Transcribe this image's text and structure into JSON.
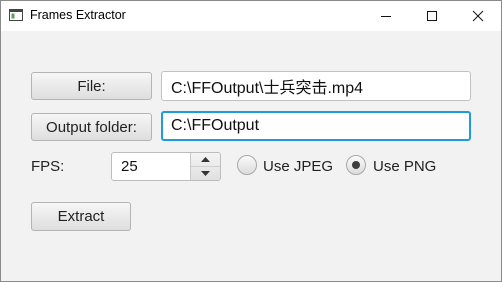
{
  "window": {
    "title": "Frames Extractor",
    "icons": [
      "app-window-icon",
      "minimize-icon",
      "maximize-icon",
      "close-icon"
    ]
  },
  "form": {
    "file_button": "File:",
    "file_path": "C:\\FFOutput\\士兵突击.mp4",
    "output_button": "Output folder:",
    "output_path": "C:\\FFOutput",
    "fps_label": "FPS:",
    "fps_value": "25",
    "jpeg_label": "Use JPEG",
    "png_label": "Use PNG",
    "selected_format": "Use PNG",
    "extract_button": "Extract"
  },
  "colors": {
    "focus_border": "#1f9bd8",
    "window_bg": "#f2f2f2"
  }
}
